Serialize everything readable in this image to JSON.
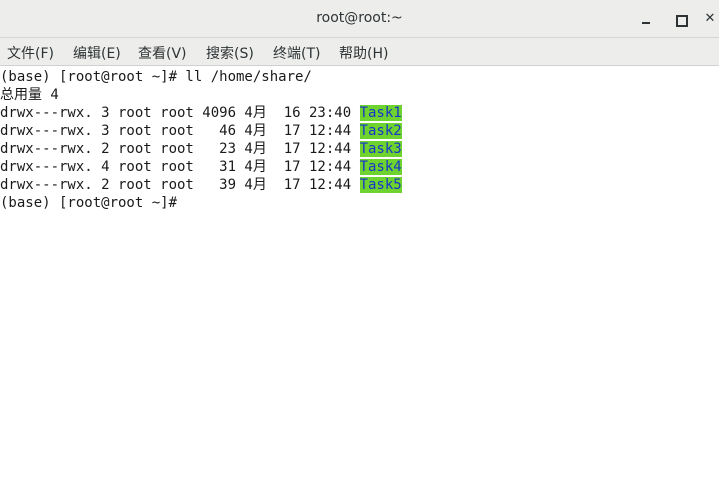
{
  "window": {
    "title": "root@root:~"
  },
  "menu": {
    "items": [
      {
        "label": "文件(F)"
      },
      {
        "label": "编辑(E)"
      },
      {
        "label": "查看(V)"
      },
      {
        "label": "搜索(S)"
      },
      {
        "label": "终端(T)"
      },
      {
        "label": "帮助(H)"
      }
    ]
  },
  "terminal": {
    "command_line": "(base) [root@root ~]# ll /home/share/",
    "total_line": "总用量 4",
    "entries": [
      {
        "prefix": "drwx---rwx. 3 root root 4096 4月  16 23:40 ",
        "name": "Task1"
      },
      {
        "prefix": "drwx---rwx. 3 root root   46 4月  17 12:44 ",
        "name": "Task2"
      },
      {
        "prefix": "drwx---rwx. 2 root root   23 4月  17 12:44 ",
        "name": "Task3"
      },
      {
        "prefix": "drwx---rwx. 4 root root   31 4月  17 12:44 ",
        "name": "Task4"
      },
      {
        "prefix": "drwx---rwx. 2 root root   39 4月  17 12:44 ",
        "name": "Task5"
      }
    ],
    "prompt_line": "(base) [root@root ~]# "
  },
  "colors": {
    "dir_highlight_bg": "#6fd32f",
    "dir_highlight_fg": "#1735c8"
  }
}
